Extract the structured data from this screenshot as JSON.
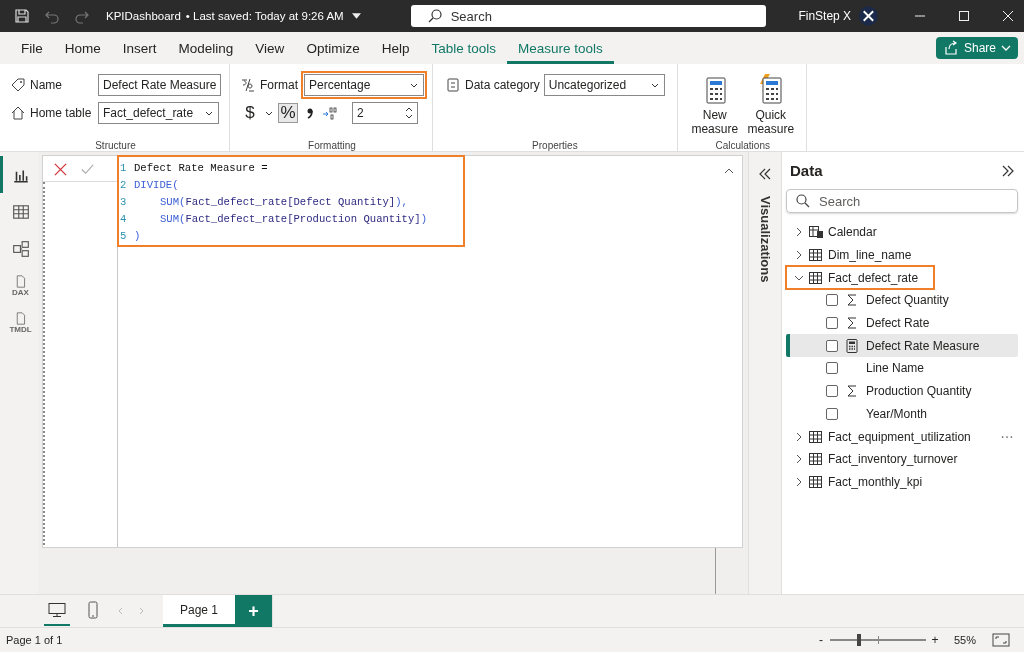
{
  "title_bar": {
    "file_name": "KPIDashboard",
    "save_status": "• Last saved: Today at 9:26 AM",
    "search_placeholder": "Search",
    "user": "FinStep X"
  },
  "menu_tabs": [
    {
      "label": "File",
      "kind": "standard",
      "selected": false
    },
    {
      "label": "Home",
      "kind": "standard",
      "selected": false
    },
    {
      "label": "Insert",
      "kind": "standard",
      "selected": false
    },
    {
      "label": "Modeling",
      "kind": "standard",
      "selected": false
    },
    {
      "label": "View",
      "kind": "standard",
      "selected": false
    },
    {
      "label": "Optimize",
      "kind": "standard",
      "selected": false
    },
    {
      "label": "Help",
      "kind": "standard",
      "selected": false
    },
    {
      "label": "Table tools",
      "kind": "contextual",
      "selected": false
    },
    {
      "label": "Measure tools",
      "kind": "contextual",
      "selected": true
    }
  ],
  "share_button": "Share",
  "ribbon": {
    "structure": {
      "name_label": "Name",
      "name_value": "Defect Rate Measure",
      "home_table_label": "Home table",
      "home_table_value": "Fact_defect_rate",
      "group_label": "Structure"
    },
    "formatting": {
      "format_label": "Format",
      "format_value": "Percentage",
      "format_highlighted": true,
      "currency_symbol": "$",
      "percent_symbol": "%",
      "percent_selected": true,
      "decimal_places": "2",
      "group_label": "Formatting"
    },
    "properties": {
      "data_category_label": "Data category",
      "data_category_value": "Uncategorized",
      "group_label": "Properties"
    },
    "calculations": {
      "buttons": [
        "New measure",
        "Quick measure"
      ],
      "group_label": "Calculations"
    }
  },
  "view_rail": [
    {
      "kind": "report",
      "selected": true
    },
    {
      "kind": "table",
      "selected": false
    },
    {
      "kind": "model",
      "selected": false
    },
    {
      "kind": "dax",
      "label": "DAX",
      "selected": false
    },
    {
      "kind": "tmdl",
      "label": "TMDL",
      "selected": false
    }
  ],
  "formula_editor": {
    "highlighted": true,
    "lines": [
      {
        "number": "1",
        "indented": false,
        "tokens": [
          {
            "text": "Defect Rate Measure =",
            "kind": "plain"
          }
        ]
      },
      {
        "number": "2",
        "indented": false,
        "tokens": [
          {
            "text": "DIVIDE(",
            "kind": "function"
          }
        ]
      },
      {
        "number": "3",
        "indented": true,
        "tokens": [
          {
            "text": "SUM(",
            "kind": "function"
          },
          {
            "text": "Fact_defect_rate[Defect Quantity]",
            "kind": "reference"
          },
          {
            "text": "),",
            "kind": "function"
          }
        ]
      },
      {
        "number": "4",
        "indented": true,
        "tokens": [
          {
            "text": "SUM(",
            "kind": "function"
          },
          {
            "text": "Fact_defect_rate[Production Quantity]",
            "kind": "reference"
          },
          {
            "text": ")",
            "kind": "function"
          }
        ]
      },
      {
        "number": "5",
        "indented": false,
        "tokens": [
          {
            "text": ")",
            "kind": "function"
          }
        ]
      }
    ]
  },
  "visualizations_pane": {
    "title": "Visualizations"
  },
  "data_pane": {
    "title": "Data",
    "search_placeholder": "Search",
    "tree": [
      {
        "label": "Calendar",
        "kind": "calendar",
        "expanded": false,
        "highlighted": false,
        "hovered": false
      },
      {
        "label": "Dim_line_name",
        "kind": "table",
        "expanded": false,
        "highlighted": false,
        "hovered": false
      },
      {
        "label": "Fact_defect_rate",
        "kind": "table",
        "expanded": true,
        "highlighted": true,
        "hovered": false,
        "children": [
          {
            "label": "Defect Quantity",
            "kind": "sum",
            "checked": false,
            "selected": false
          },
          {
            "label": "Defect Rate",
            "kind": "sum",
            "checked": false,
            "selected": false
          },
          {
            "label": "Defect Rate Measure",
            "kind": "measure",
            "checked": false,
            "selected": true
          },
          {
            "label": "Line Name",
            "kind": "text",
            "checked": false,
            "selected": false
          },
          {
            "label": "Production Quantity",
            "kind": "sum",
            "checked": false,
            "selected": false
          },
          {
            "label": "Year/Month",
            "kind": "text",
            "checked": false,
            "selected": false
          }
        ]
      },
      {
        "label": "Fact_equipment_utilization",
        "kind": "table",
        "expanded": false,
        "highlighted": false,
        "hovered": true
      },
      {
        "label": "Fact_inventory_turnover",
        "kind": "table",
        "expanded": false,
        "highlighted": false,
        "hovered": false
      },
      {
        "label": "Fact_monthly_kpi",
        "kind": "table",
        "expanded": false,
        "highlighted": false,
        "hovered": false
      }
    ]
  },
  "page_bar": {
    "views": [
      {
        "kind": "desktop",
        "selected": true
      },
      {
        "kind": "mobile",
        "selected": false
      }
    ],
    "pages": [
      {
        "label": "Page 1",
        "selected": true
      }
    ],
    "add_label": "+"
  },
  "status_bar": {
    "page_info": "Page 1 of 1",
    "zoom_out": "-",
    "zoom_in": "+",
    "zoom": {
      "level": 0.3
    },
    "zoom_value": "55%"
  }
}
